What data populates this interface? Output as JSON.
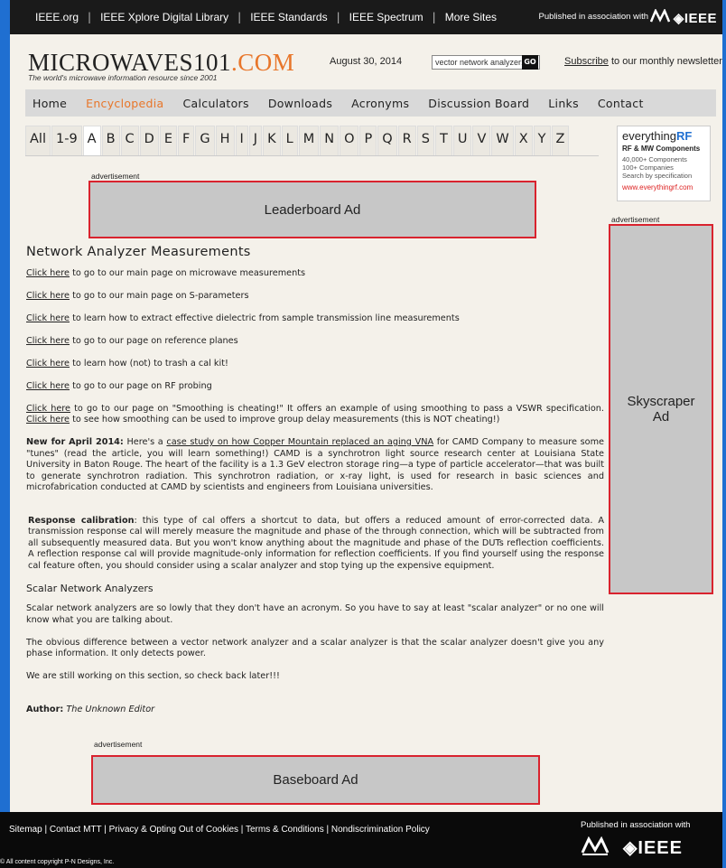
{
  "topbar": {
    "links": [
      "IEEE.org",
      "IEEE Xplore Digital Library",
      "IEEE Standards",
      "IEEE Spectrum",
      "More Sites"
    ],
    "published": "Published in association with",
    "ieee": "IEEE"
  },
  "header": {
    "logo_part1": "MICROWAVES101",
    "logo_part2": ".COM",
    "tagline": "The world's microwave information resource since 2001",
    "date": "August 30, 2014",
    "search_value": "vector network analyzer:",
    "go_label": "GO",
    "subscribe_link": "Subscribe",
    "subscribe_text": " to our monthly newsletter"
  },
  "nav": {
    "items": [
      "Home",
      "Encyclopedia",
      "Calculators",
      "Downloads",
      "Acronyms",
      "Discussion Board",
      "Links",
      "Contact"
    ],
    "active": "Encyclopedia"
  },
  "alphabet": [
    "All",
    "1-9",
    "A",
    "B",
    "C",
    "D",
    "E",
    "F",
    "G",
    "H",
    "I",
    "J",
    "K",
    "L",
    "M",
    "N",
    "O",
    "P",
    "Q",
    "R",
    "S",
    "T",
    "U",
    "V",
    "W",
    "X",
    "Y",
    "Z"
  ],
  "sidebar_ad": {
    "brand": "everything",
    "brand_bold": "RF",
    "sub": "RF & MW Components",
    "line1": "40,000+ Components",
    "line2": "100+ Companies",
    "line3": "Search by specification",
    "url": "www.everythingrf.com"
  },
  "ads": {
    "label": "advertisement",
    "leaderboard": "Leaderboard Ad",
    "skyscraper": "Skyscraper Ad",
    "baseboard": "Baseboard Ad"
  },
  "article": {
    "title": "Network Analyzer Measurements",
    "click_here": "Click here",
    "links": [
      " to go to our main page on microwave measurements",
      " to go to our main page on S-parameters",
      " to learn how to extract effective dielectric from sample transmission line measurements",
      " to go to our page on reference planes",
      " to learn how (not) to trash a cal kit!",
      " to go to our page on RF probing"
    ],
    "smoothing_pre": " to go to our page on \"Smoothing is cheating!\" It offers an example of using smoothing to pass a VSWR specification. ",
    "smoothing_post": " to see how smoothing can be used to improve group delay measurements (this is NOT cheating!)",
    "new_label": "New for April 2014:",
    "new_pre": " Here's a ",
    "new_link": "case study on how Copper Mountain replaced an aging VNA",
    "new_post": " for CAMD Company to measure some \"tunes\" (read the article, you will learn something!) CAMD is a synchrotron light source research center at Louisiana State University in Baton Rouge. The heart of the facility is a 1.3 GeV electron storage ring—a type of particle accelerator—that was built to generate synchrotron radiation. This synchrotron radiation, or x-ray light, is used for research in basic sciences and microfabrication conducted at CAMD by scientists and engineers from Louisiana universities.",
    "response_label": "Response calibration",
    "response_text": ": this type of cal offers a shortcut to data, but offers a reduced amount of error-corrected data. A transmission response cal will merely measure the magnitude and phase of the through connection, which will be subtracted from all subsequently measured data. But you won't know anything about the magnitude and phase of the DUTs reflection coefficients. A reflection response cal will provide magnitude-only information for reflection coefficients. If you find yourself using the response cal feature often, you should consider using a scalar analyzer and stop tying up the expensive equipment.",
    "scalar_heading": "Scalar Network Analyzers",
    "scalar_p1": "Scalar network analyzers are so lowly that they don't have an acronym. So you have to say at least \"scalar analyzer\" or no one will know what you are talking about.",
    "scalar_p2": "The obvious difference between a vector network analyzer and a scalar analyzer is that the scalar analyzer doesn't give you any phase information. It only detects power.",
    "scalar_p3": "We are still working on this section, so check back later!!!",
    "author_label": "Author:",
    "author_name": "The Unknown Editor"
  },
  "footer": {
    "links": [
      "Sitemap",
      "Contact MTT",
      "Privacy & Opting Out of Cookies",
      "Terms & Conditions",
      "Nondiscrimination Policy"
    ],
    "copyright": "© All content copyright P-N Designs, Inc.",
    "published": "Published in association with",
    "ieee": "IEEE"
  }
}
